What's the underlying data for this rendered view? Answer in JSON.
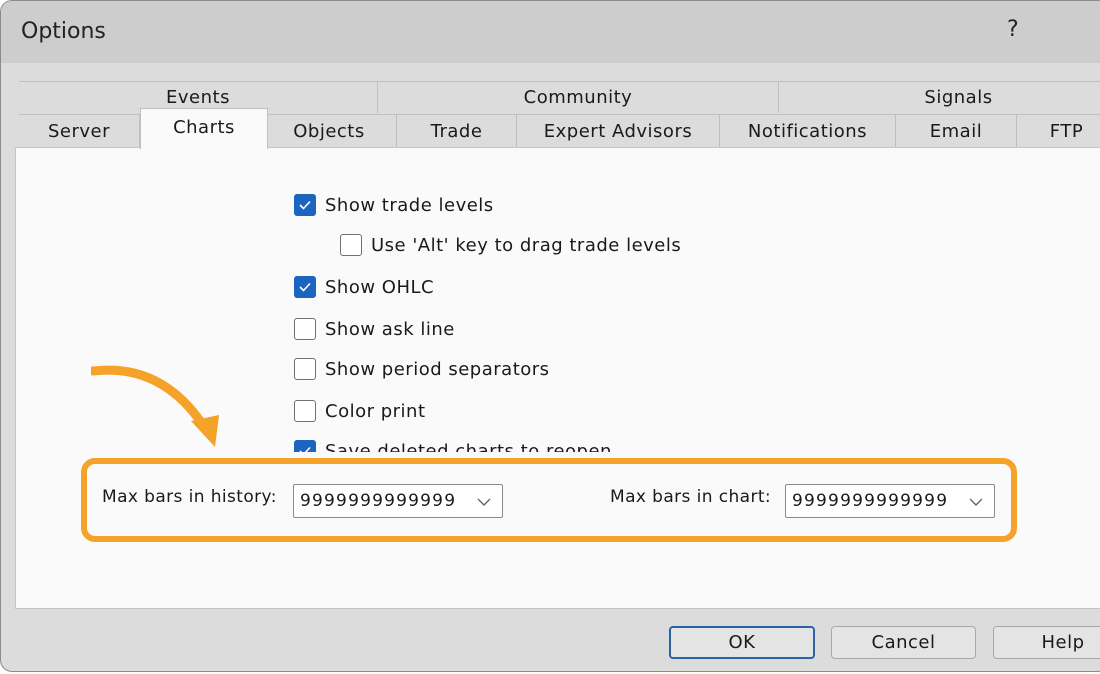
{
  "window": {
    "title": "Options",
    "help_glyph": "?"
  },
  "tabs": {
    "top_row": [
      "Events",
      "Community",
      "Signals"
    ],
    "bottom_row": [
      "Server",
      "Charts",
      "Objects",
      "Trade",
      "Expert Advisors",
      "Notifications",
      "Email",
      "FTP"
    ],
    "active": "Charts"
  },
  "options": [
    {
      "label": "Show trade levels",
      "checked": true
    },
    {
      "label": "Use 'Alt' key to drag trade levels",
      "checked": false
    },
    {
      "label": "Show OHLC",
      "checked": true
    },
    {
      "label": "Show ask line",
      "checked": false
    },
    {
      "label": "Show period separators",
      "checked": false
    },
    {
      "label": "Color print",
      "checked": false
    },
    {
      "label": "Save deleted charts to reopen",
      "checked": true
    }
  ],
  "history": {
    "label": "Max bars in history:",
    "value": "9999999999999"
  },
  "chart": {
    "label": "Max bars in chart:",
    "value": "9999999999999"
  },
  "buttons": {
    "ok": "OK",
    "cancel": "Cancel",
    "help": "Help"
  },
  "colors": {
    "accent_check": "#1b65c0",
    "highlight": "#f4a228",
    "ok_border": "#2a62a8"
  }
}
